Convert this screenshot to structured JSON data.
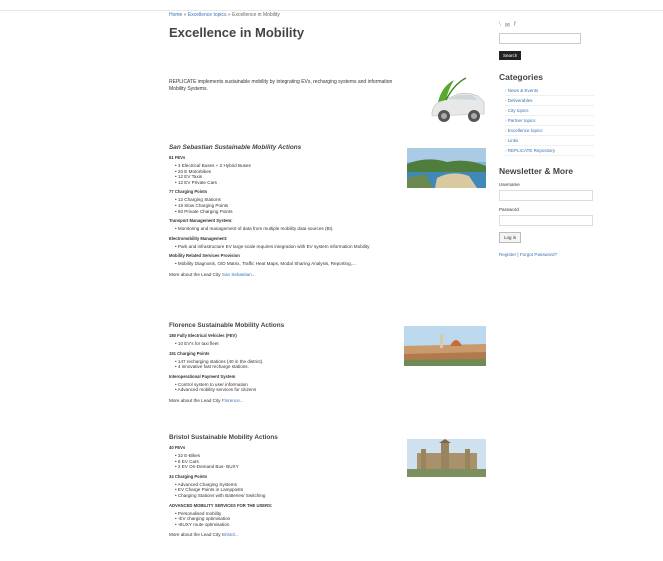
{
  "breadcrumb": {
    "home": "Home",
    "sep1": " » ",
    "topics": "Excellence topics",
    "sep2": " » ",
    "current": "Excellence in Mobility"
  },
  "page_title": "Excellence in Mobility",
  "intro": "REPLICATE implements sustainable mobility by integrating EVs, recharging systems and information Mobility Systems.",
  "san_sebastian": {
    "title": "San Sebastian Sustainable Mobility Actions",
    "g1_title": "61 FEVs",
    "g1_items": [
      "3 Electrical Buses + 2 Hybrid Buses",
      "20 E Motorbikes",
      "12 EV Taxis",
      "12 EV Private Cars"
    ],
    "g2_title": "77 Charging Points",
    "g2_items": [
      "12 Charging Stations",
      "15 Slow Charging Points",
      "50 Private Charging Points"
    ],
    "g3_title": "Transport Management System:",
    "g3_items": [
      "Monitoring and management of data from multiple mobility data sources (BI)."
    ],
    "g4_title": "Electromobility Management:",
    "g4_items": [
      "Park and infrastructure EV large scale requires integration with EV system information Mobility"
    ],
    "g5_title": "Mobility Related Services Provision",
    "g5_items": [
      "Mobility Diagnosis, O/D Matrix, Traffic Heat Maps, Modal Sharing Analysis, Reporting,..."
    ],
    "more_text": "More about the Lead City ",
    "more_link": "San Sebastian..."
  },
  "florence": {
    "title": "Florence Sustainable Mobility Actions",
    "g1_title": "180 Fully Electrical Vehicles (FEV)",
    "g1_items": [
      "10 EV's for taxi fleet"
    ],
    "g2_title": "151 Charging Points",
    "g2_items": [
      "147 recharging stations (40 in the district).",
      "4 innovative fast recharge stations."
    ],
    "g3_title": "Interoperational Payment System",
    "g3_items": [
      "Control system to user information",
      "Advanced mobility services for citizens"
    ],
    "more_text": "More about the Lead City ",
    "more_link": "Florence..."
  },
  "bristol": {
    "title": "Bristol Sustainable Mobility Actions",
    "g1_title": "40 FEVs",
    "g1_items": [
      "32 E-Bikes",
      "6 EV Cars",
      "2 EV On-Demand Bus- BUXY"
    ],
    "g2_title": "34 Charging Points",
    "g2_items": [
      "Advanced Charging Systems",
      "EV Charge Points in Lampposts",
      "Charging Stations with Batteries/ Switching"
    ],
    "g3_title": "ADVANCED MOBILITY SERVICES FOR THE USERS:",
    "g3_items": [
      "Personalised mobility",
      "-EV charging optimisation",
      "-BUXY route optimisation"
    ],
    "more_text": "More about the Lead City ",
    "more_link": "Bristol..."
  },
  "sidebar": {
    "icons": [
      "rss-icon",
      "mail-icon",
      "facebook-icon"
    ],
    "icon_glyphs": [
      "⧵",
      "✉",
      "f"
    ],
    "search_button": "Search",
    "categories_title": "Categories",
    "categories": [
      "News & Events",
      "Deliverables",
      "City topics",
      "Partner topics",
      "Excellence topics",
      "Links",
      "REPLICATE Repository"
    ],
    "newsletter_title": "Newsletter & More",
    "username_label": "Username",
    "password_label": "Password",
    "login_button": "Log in",
    "register_link": "Register",
    "separator": " | ",
    "forgot_link": "Forgot Password?"
  },
  "colors": {
    "link": "#3a73b5",
    "heading": "#444444",
    "button_dark": "#222222"
  }
}
